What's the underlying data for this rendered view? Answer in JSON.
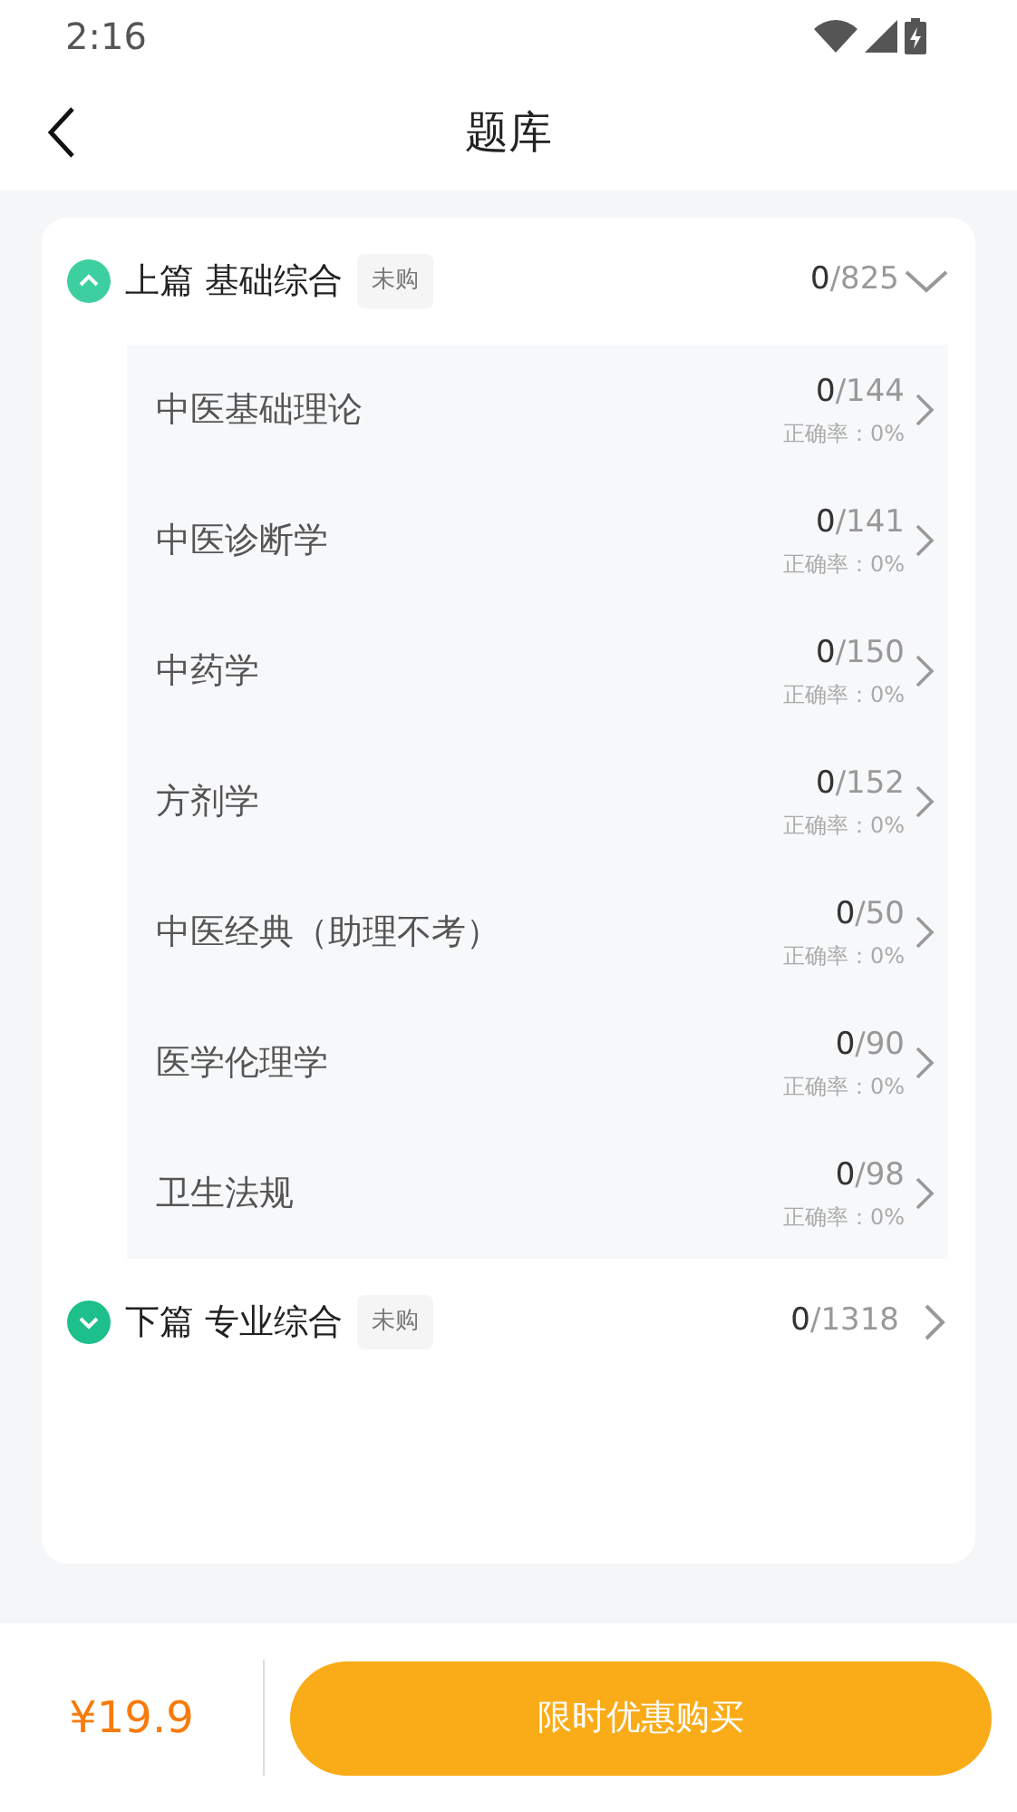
{
  "status_bar": {
    "time": "2:16"
  },
  "header": {
    "title": "题库"
  },
  "sections": [
    {
      "title": "上篇 基础综合",
      "tag": "未购",
      "done": "0",
      "total": "/825",
      "expanded": true,
      "chapters": [
        {
          "name": "中医基础理论",
          "done": "0",
          "total": "/144",
          "accuracy": "正确率：0%"
        },
        {
          "name": "中医诊断学",
          "done": "0",
          "total": "/141",
          "accuracy": "正确率：0%"
        },
        {
          "name": "中药学",
          "done": "0",
          "total": "/150",
          "accuracy": "正确率：0%"
        },
        {
          "name": "方剂学",
          "done": "0",
          "total": "/152",
          "accuracy": "正确率：0%"
        },
        {
          "name": "中医经典（助理不考）",
          "done": "0",
          "total": "/50",
          "accuracy": "正确率：0%"
        },
        {
          "name": "医学伦理学",
          "done": "0",
          "total": "/90",
          "accuracy": "正确率：0%"
        },
        {
          "name": "卫生法规",
          "done": "0",
          "total": "/98",
          "accuracy": "正确率：0%"
        }
      ]
    },
    {
      "title": "下篇 专业综合",
      "tag": "未购",
      "done": "0",
      "total": "/1318",
      "expanded": false
    }
  ],
  "footer": {
    "price": "¥19.9",
    "buy_button": "限时优惠购买"
  }
}
